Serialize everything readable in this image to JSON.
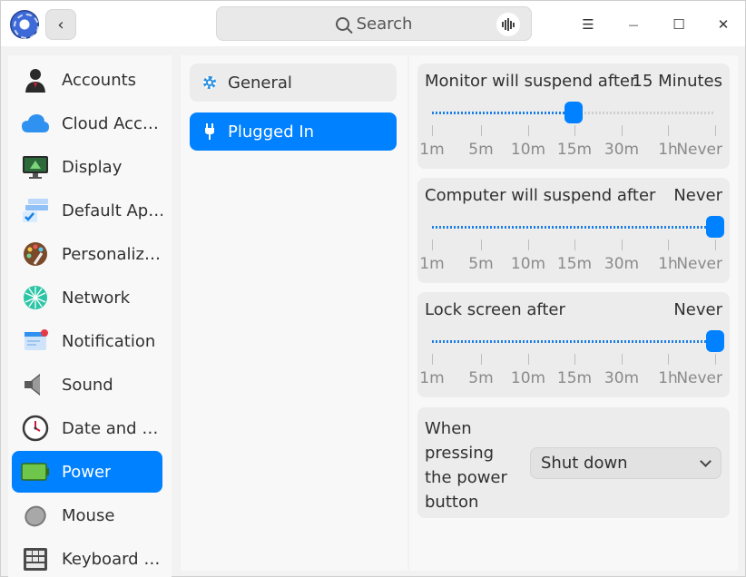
{
  "titlebar": {
    "search_placeholder": "Search",
    "back_glyph": "‹",
    "menu_glyph": "☰",
    "minimize_glyph": "—",
    "maximize_glyph": "☐",
    "close_glyph": "✕"
  },
  "sidebar": {
    "items": [
      {
        "label": "Accounts",
        "icon": "accounts-icon"
      },
      {
        "label": "Cloud Acc…",
        "icon": "cloud-icon"
      },
      {
        "label": "Display",
        "icon": "display-icon"
      },
      {
        "label": "Default Ap…",
        "icon": "default-apps-icon"
      },
      {
        "label": "Personaliz…",
        "icon": "palette-icon"
      },
      {
        "label": "Network",
        "icon": "network-icon"
      },
      {
        "label": "Notification",
        "icon": "notification-icon"
      },
      {
        "label": "Sound",
        "icon": "speaker-icon"
      },
      {
        "label": "Date and …",
        "icon": "clock-icon"
      },
      {
        "label": "Power",
        "icon": "battery-icon",
        "active": true
      },
      {
        "label": "Mouse",
        "icon": "mouse-icon"
      },
      {
        "label": "Keyboard …",
        "icon": "keyboard-icon"
      }
    ]
  },
  "middle": {
    "general_label": "General",
    "plugged_label": "Plugged In"
  },
  "settings": {
    "tick_labels": [
      "1m",
      "5m",
      "10m",
      "15m",
      "30m",
      "1h",
      "Never"
    ],
    "monitor": {
      "title": "Monitor will suspend after",
      "value": "15 Minutes",
      "level": 0.5
    },
    "computer": {
      "title": "Computer will suspend after",
      "value": "Never",
      "level": 1.0
    },
    "lock": {
      "title": "Lock screen after",
      "value": "Never",
      "level": 1.0
    },
    "power_button": {
      "label": "When pressing the power button",
      "selected": "Shut down"
    }
  },
  "colors": {
    "accent": "#0081ff",
    "panel": "#f8f8f8",
    "card": "#ececec"
  }
}
